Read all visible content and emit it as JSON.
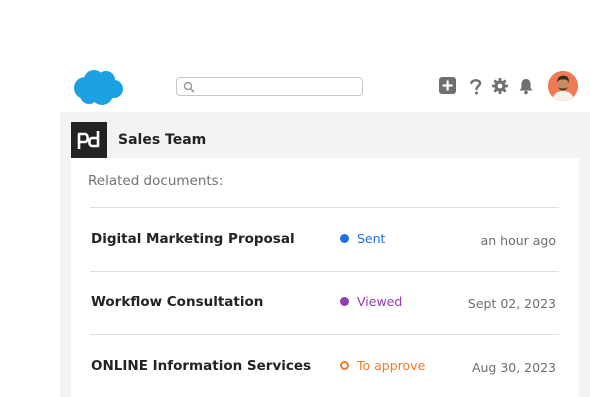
{
  "header": {
    "logo_icon": "salesforce-cloud-icon",
    "search_placeholder": "",
    "icons": [
      "add-icon",
      "help-icon",
      "gear-icon",
      "bell-icon"
    ],
    "avatar_icon": "user-avatar"
  },
  "card": {
    "logo_icon": "pandadoc-logo",
    "title": "Sales Team",
    "subtitle": "Related documents:",
    "documents": [
      {
        "name": "Digital Marketing Proposal",
        "status": "Sent",
        "status_color": "#1f6fe0",
        "status_style": "filled",
        "date": "an hour ago"
      },
      {
        "name": "Workflow Consultation",
        "status": "Viewed",
        "status_color": "#8e3fb0",
        "status_style": "filled",
        "date": "Sept 02, 2023"
      },
      {
        "name": "ONLINE Information Services",
        "status": "To approve",
        "status_color": "#f07c2a",
        "status_style": "ring",
        "date": "Aug 30, 2023"
      }
    ]
  },
  "colors": {
    "brand": "#1ba0e2",
    "panel_bg": "#f3f3f3"
  }
}
